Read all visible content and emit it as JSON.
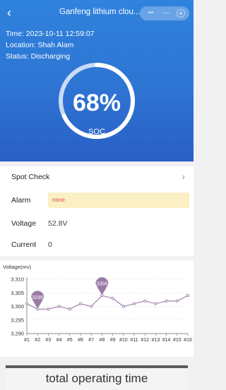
{
  "header": {
    "title": "Ganfeng lithium clou...",
    "back_icon": "chevron-left-icon",
    "menu_icons": [
      "more-dots-icon",
      "minimize-icon",
      "close-target-icon"
    ]
  },
  "status": {
    "time_label": "Time:",
    "time_value": "2023-10-11 12:59:07",
    "location_label": "Location:",
    "location_value": "Shah Alam",
    "status_label": "Status:",
    "status_value": "Discharging"
  },
  "gauge": {
    "percent": 68,
    "value_text": "68%",
    "label": "SOC",
    "track_color": "#c9dcf5",
    "fill_color": "#ffffff"
  },
  "details": {
    "spot_check_label": "Spot Check",
    "alarm_label": "Alarm",
    "alarm_value": "none",
    "voltage_label": "Voltage",
    "voltage_value": "52.8V",
    "current_label": "Current",
    "current_value": "0"
  },
  "chart_data": {
    "type": "line",
    "ylabel": "Voltage(mv)",
    "categories": [
      "#1",
      "#2",
      "#3",
      "#4",
      "#5",
      "#6",
      "#7",
      "#8",
      "#9",
      "#10",
      "#11",
      "#12",
      "#13",
      "#14",
      "#15",
      "#16"
    ],
    "values": [
      3301,
      3299,
      3299,
      3300,
      3299,
      3301,
      3300,
      3304,
      3303,
      3300,
      3301,
      3302,
      3301,
      3302,
      3302,
      3304
    ],
    "ylim": [
      3290,
      3310
    ],
    "yticks": [
      "3,290",
      "3,295",
      "3,300",
      "3,305",
      "3,310"
    ],
    "markers": [
      {
        "category": "#2",
        "value": 3299,
        "label": "3299"
      },
      {
        "category": "#8",
        "value": 3304,
        "label": "3304"
      }
    ],
    "line_color": "#9b7ba6",
    "grid": true
  },
  "footer": {
    "label": "total operating time"
  }
}
